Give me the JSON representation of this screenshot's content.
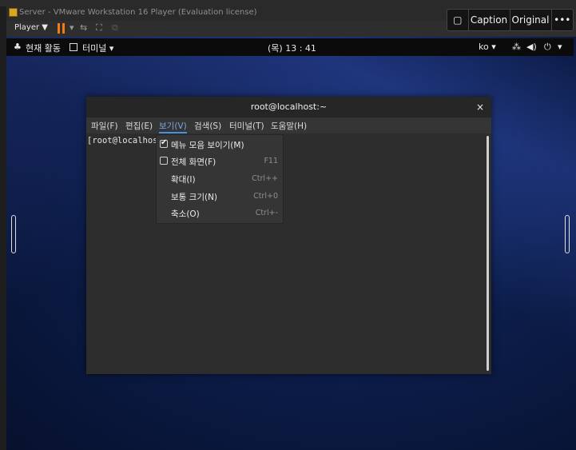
{
  "vmware": {
    "title": "Server - VMware Workstation 16 Player (Evaluation license)",
    "player_label": "Player ▼",
    "overlay": {
      "caption": "Caption",
      "original": "Original",
      "more": "•••"
    }
  },
  "gnome": {
    "activities": "현재 활동",
    "terminal_app": "터미널 ▾",
    "clock": "(목) 13 : 41",
    "input_method": "ko ▾",
    "system_menu": "▾"
  },
  "terminal": {
    "title": "root@localhost:~",
    "close": "×",
    "menus": [
      "파일(F)",
      "편집(E)",
      "보기(V)",
      "검색(S)",
      "터미널(T)",
      "도움말(H)"
    ],
    "prompt": "[root@localhos"
  },
  "view_menu": {
    "items": [
      {
        "label": "메뉴 모음 보이기(M)",
        "shortcut": "",
        "checkbox": true,
        "checked": true
      },
      {
        "label": "전체 화면(F)",
        "shortcut": "F11",
        "checkbox": true,
        "checked": false
      },
      {
        "label": "확대(I)",
        "shortcut": "Ctrl++",
        "checkbox": false
      },
      {
        "label": "보통 크기(N)",
        "shortcut": "Ctrl+0",
        "checkbox": false
      },
      {
        "label": "축소(O)",
        "shortcut": "Ctrl+-",
        "checkbox": false
      }
    ]
  },
  "colors": {
    "accent_orange": "#f07c12",
    "active_menu": "#4a8fe0"
  }
}
